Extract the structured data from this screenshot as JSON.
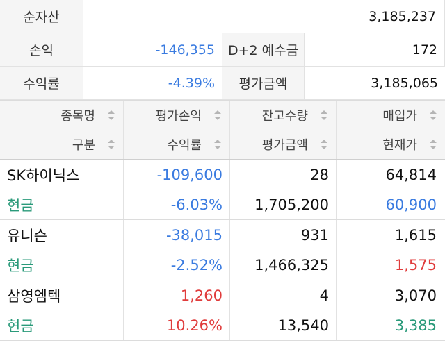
{
  "summary": {
    "net_assets_label": "순자산",
    "net_assets_value": "3,185,237",
    "pnl_label": "손익",
    "pnl_value": "-146,355",
    "deposit_label": "D+2 예수금",
    "deposit_value": "172",
    "return_label": "수익률",
    "return_value": "-4.39%",
    "eval_label": "평가금액",
    "eval_value": "3,185,065"
  },
  "header": {
    "row1": [
      "종목명",
      "평가손익",
      "잔고수량",
      "매입가"
    ],
    "row2": [
      "구분",
      "수익률",
      "평가금액",
      "현재가"
    ]
  },
  "holdings": [
    {
      "name": "SK하이닉스",
      "type": "현금",
      "pnl": "-109,600",
      "rate": "-6.03%",
      "qty": "28",
      "eval": "1,705,200",
      "buy": "64,814",
      "current": "60,900"
    },
    {
      "name": "유니슨",
      "type": "현금",
      "pnl": "-38,015",
      "rate": "-2.52%",
      "qty": "931",
      "eval": "1,466,325",
      "buy": "1,615",
      "current": "1,575"
    },
    {
      "name": "삼영엠텍",
      "type": "현금",
      "pnl": "1,260",
      "rate": "10.26%",
      "qty": "4",
      "eval": "13,540",
      "buy": "3,070",
      "current": "3,385"
    }
  ],
  "colors": {
    "negative": "#3a7be0",
    "positive": "#e03c3c",
    "cash": "#2a9a7a"
  }
}
